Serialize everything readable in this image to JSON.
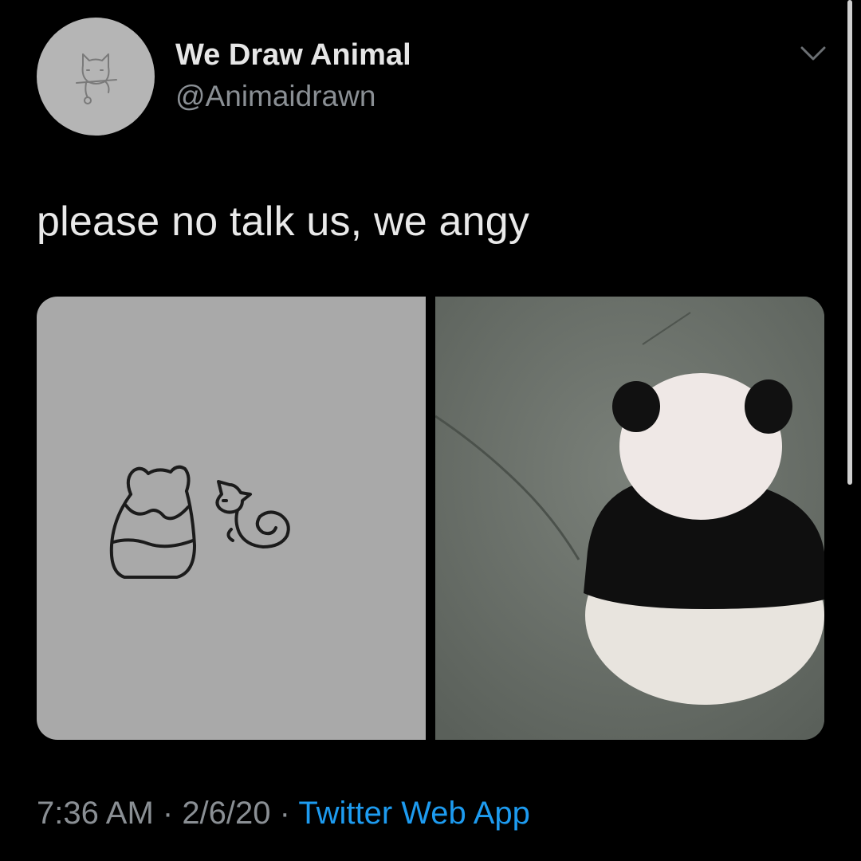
{
  "tweet": {
    "display_name": "We Draw Animal",
    "handle": "@Animaidrawn",
    "text": "please no talk us, we angy",
    "time": "7:36 AM",
    "date": "2/6/20",
    "separator": " · ",
    "source": "Twitter Web App",
    "avatar_icon": "cat-on-branch-drawing",
    "media": [
      {
        "icon": "panda-and-cat-line-drawing"
      },
      {
        "icon": "panda-back-photo"
      }
    ]
  },
  "colors": {
    "background": "#000000",
    "display_name": "#e6e6e6",
    "secondary_text": "#8a8f94",
    "link": "#1d9bf0",
    "avatar_bg": "#b5b5b5",
    "drawing_bg": "#a9a9a9"
  }
}
